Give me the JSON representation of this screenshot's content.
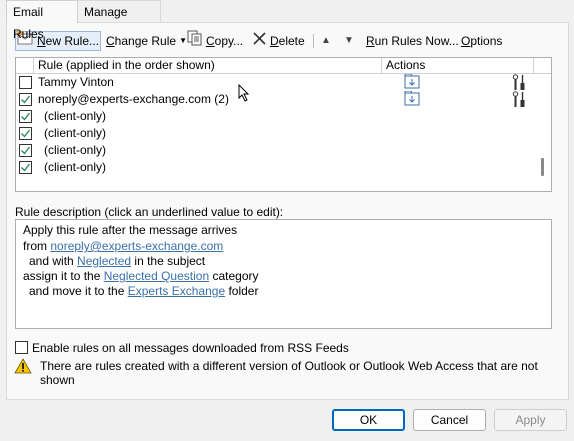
{
  "tabs": [
    {
      "label": "Email Rules",
      "active": true
    },
    {
      "label": "Manage Alerts",
      "active": false
    }
  ],
  "toolbar": {
    "new_rule": "New Rule...",
    "change_rule": "Change Rule",
    "copy": "Copy...",
    "delete": "Delete",
    "run_rules_now": "Run Rules Now...",
    "options": "Options"
  },
  "rule_list": {
    "columns": [
      "Rule (applied in the order shown)",
      "Actions"
    ],
    "rows": [
      {
        "name": "Tammy Vinton",
        "checked": false,
        "has_actions": true
      },
      {
        "name": "noreply@experts-exchange.com (2)",
        "checked": true,
        "has_actions": true
      },
      {
        "name": "(client-only)",
        "checked": true,
        "has_actions": false
      },
      {
        "name": "(client-only)",
        "checked": true,
        "has_actions": false
      },
      {
        "name": "(client-only)",
        "checked": true,
        "has_actions": false
      },
      {
        "name": "(client-only)",
        "checked": true,
        "has_actions": false
      }
    ]
  },
  "description": {
    "label": "Rule description (click an underlined value to edit):",
    "line1": "Apply this rule after the message arrives",
    "line2_prefix": "from ",
    "line2_link": "noreply@experts-exchange.com",
    "line3_prefix": "and with ",
    "line3_link": "Neglected",
    "line3_suffix": " in the subject",
    "line4_prefix": "assign it to the ",
    "line4_link": "Neglected Question",
    "line4_suffix": " category",
    "line5_prefix": "and move it to the ",
    "line5_link": "Experts Exchange",
    "line5_suffix": " folder"
  },
  "rss": {
    "label": "Enable rules on all messages downloaded from RSS Feeds",
    "checked": false
  },
  "warning": {
    "line1": "There are rules created with a different version of Outlook or Outlook Web Access that are not",
    "line2": "shown"
  },
  "buttons": {
    "ok": "OK",
    "cancel": "Cancel",
    "apply": "Apply"
  },
  "colors": {
    "link": "#3b6fa8",
    "check": "#2e8b57",
    "ok_border": "#0067c0",
    "warning": "#f5c400"
  }
}
